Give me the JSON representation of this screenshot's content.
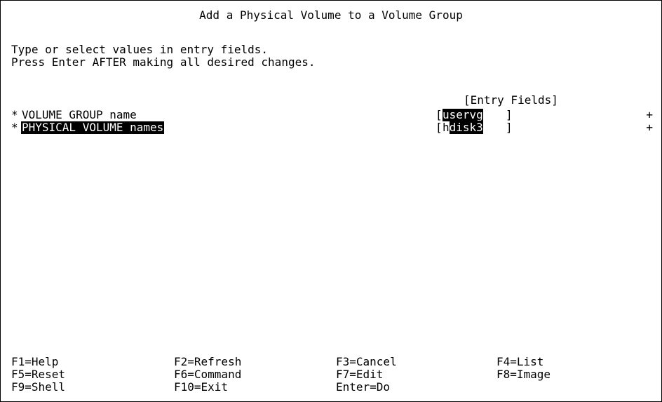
{
  "title": "Add a Physical Volume to a Volume Group",
  "instructions": [
    "Type or select values in entry fields.",
    "Press Enter AFTER making all desired changes."
  ],
  "entry_fields_header": "[Entry Fields]",
  "fields": [
    {
      "required_marker": "*",
      "label": "VOLUME GROUP name",
      "bracket_open": "[",
      "value": "uservg",
      "bracket_close": "]",
      "list_marker": "+"
    },
    {
      "required_marker": "*",
      "label": "PHYSICAL VOLUME names",
      "bracket_open": "[",
      "value_cursor": "h",
      "value_rest": "disk3",
      "bracket_close": "]",
      "list_marker": "+"
    }
  ],
  "function_keys": [
    [
      "F1=Help",
      "F2=Refresh",
      "F3=Cancel",
      "F4=List"
    ],
    [
      "F5=Reset",
      "F6=Command",
      "F7=Edit",
      "F8=Image"
    ],
    [
      "F9=Shell",
      "F10=Exit",
      "Enter=Do",
      ""
    ]
  ]
}
